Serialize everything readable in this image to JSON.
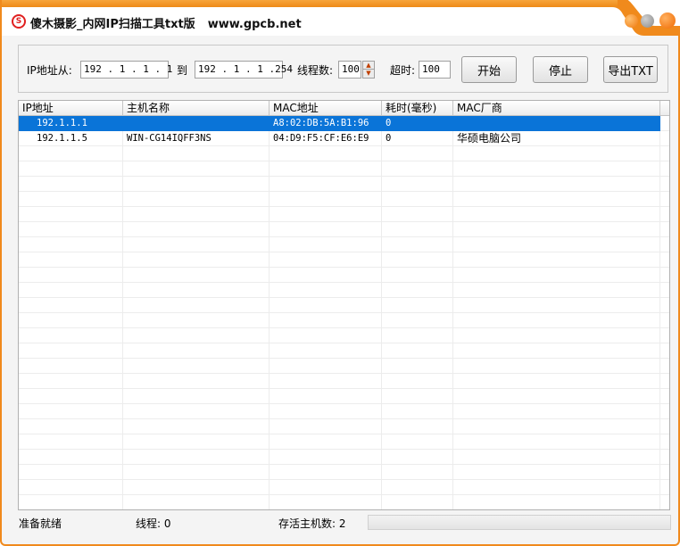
{
  "title": {
    "logo_text": "S",
    "app_name": "傻木摄影_内网IP扫描工具txt版",
    "url": "www.gpcb.net"
  },
  "toolbar": {
    "ip_from_label": "IP地址从:",
    "ip_from_value": "192 . 1   . 1   . 1",
    "to_label": "到",
    "ip_to_value": "192 . 1   . 1   .254",
    "threads_label": "线程数:",
    "threads_value": "100",
    "timeout_label": "超时:",
    "timeout_value": "100",
    "start_label": "开始",
    "stop_label": "停止",
    "export_label": "导出TXT"
  },
  "table": {
    "headers": [
      "IP地址",
      "主机名称",
      "MAC地址",
      "耗时(毫秒)",
      "MAC厂商"
    ],
    "rows": [
      {
        "ip": "192.1.1.1",
        "host": "",
        "mac": "A8:02:DB:5A:B1:96",
        "time": "0",
        "vendor": ""
      },
      {
        "ip": "192.1.1.5",
        "host": "WIN-CG14IQFF3NS",
        "mac": "04:D9:F5:CF:E6:E9",
        "time": "0",
        "vendor": "华硕电脑公司"
      }
    ]
  },
  "status": {
    "state": "准备就绪",
    "threads": "线程:  0",
    "alive": "存活主机数: 2"
  },
  "colors": {
    "accent": "#f08a1c",
    "selection": "#0a74d8"
  }
}
